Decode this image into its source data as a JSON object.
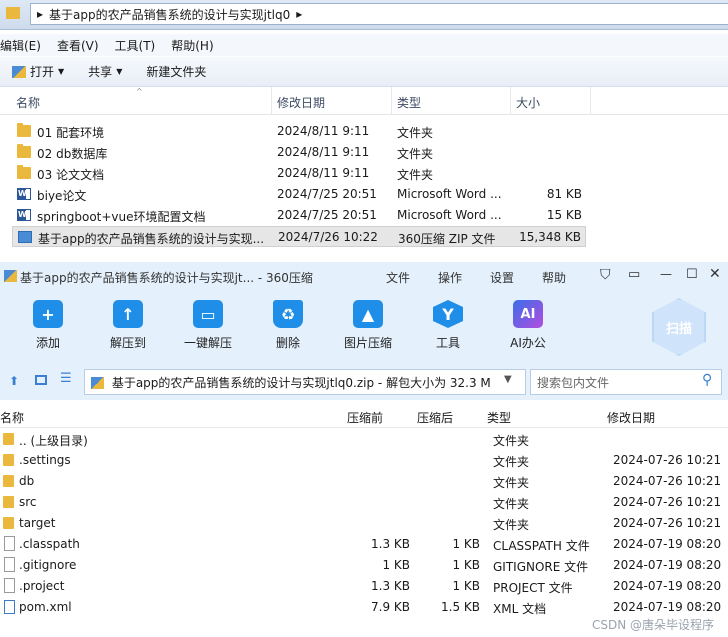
{
  "explorer": {
    "path": "基于app的农产品销售系统的设计与实现jtlq0",
    "menu": [
      "编辑(E)",
      "查看(V)",
      "工具(T)",
      "帮助(H)"
    ],
    "toolbar": {
      "open": "打开",
      "share": "共享",
      "new_folder": "新建文件夹"
    },
    "columns": {
      "name": "名称",
      "date": "修改日期",
      "type": "类型",
      "size": "大小"
    },
    "files": [
      {
        "name": "01 配套环境",
        "date": "2024/8/11 9:11",
        "type": "文件夹",
        "size": "",
        "icon": "folder-icon"
      },
      {
        "name": "02 db数据库",
        "date": "2024/8/11 9:11",
        "type": "文件夹",
        "size": "",
        "icon": "folder-icon"
      },
      {
        "name": "03 论文文档",
        "date": "2024/8/11 9:11",
        "type": "文件夹",
        "size": "",
        "icon": "folder-icon"
      },
      {
        "name": "biye论文",
        "date": "2024/7/25 20:51",
        "type": "Microsoft Word ...",
        "size": "81 KB",
        "icon": "word-doc-icon"
      },
      {
        "name": "springboot+vue环境配置文档",
        "date": "2024/7/25 20:51",
        "type": "Microsoft Word ...",
        "size": "15 KB",
        "icon": "word-doc-icon"
      },
      {
        "name": "基于app的农产品销售系统的设计与实现...",
        "date": "2024/7/26 10:22",
        "type": "360压缩 ZIP 文件",
        "size": "15,348 KB",
        "icon": "zip-icon"
      }
    ]
  },
  "zip": {
    "title": "基于app的农产品销售系统的设计与实现jt... - 360压缩",
    "menu": [
      "文件",
      "操作",
      "设置",
      "帮助"
    ],
    "tools": [
      {
        "label": "添加",
        "icon": "add-icon",
        "color": "#1e8ee8"
      },
      {
        "label": "解压到",
        "icon": "extract-to-icon",
        "color": "#1e8ee8"
      },
      {
        "label": "一键解压",
        "icon": "one-click-extract-icon",
        "color": "#1e8ee8"
      },
      {
        "label": "删除",
        "icon": "delete-icon",
        "color": "#1e8ee8"
      },
      {
        "label": "图片压缩",
        "icon": "image-compress-icon",
        "color": "#1e8ee8"
      },
      {
        "label": "工具",
        "icon": "tools-icon",
        "color": "#1e8ee8"
      },
      {
        "label": "AI办公",
        "icon": "ai-office-icon",
        "color": "#3a6fe8"
      }
    ],
    "scan_label": "扫描",
    "path": "基于app的农产品销售系统的设计与实现jtlq0.zip - 解包大小为 32.3 M",
    "search_placeholder": "搜索包内文件",
    "columns": {
      "name": "名称",
      "compressed": "压缩前",
      "after": "压缩后",
      "type": "类型",
      "modified": "修改日期"
    },
    "entries": [
      {
        "name": ".. (上级目录)",
        "before": "",
        "after": "",
        "type": "文件夹",
        "date": "",
        "icon": "folder-icon"
      },
      {
        "name": ".settings",
        "before": "",
        "after": "",
        "type": "文件夹",
        "date": "2024-07-26 10:21",
        "icon": "folder-icon"
      },
      {
        "name": "db",
        "before": "",
        "after": "",
        "type": "文件夹",
        "date": "2024-07-26 10:21",
        "icon": "folder-icon"
      },
      {
        "name": "src",
        "before": "",
        "after": "",
        "type": "文件夹",
        "date": "2024-07-26 10:21",
        "icon": "folder-icon"
      },
      {
        "name": "target",
        "before": "",
        "after": "",
        "type": "文件夹",
        "date": "2024-07-26 10:21",
        "icon": "folder-icon"
      },
      {
        "name": ".classpath",
        "before": "1.3 KB",
        "after": "1 KB",
        "type": "CLASSPATH 文件",
        "date": "2024-07-19 08:20",
        "icon": "file-icon"
      },
      {
        "name": ".gitignore",
        "before": "1 KB",
        "after": "1 KB",
        "type": "GITIGNORE 文件",
        "date": "2024-07-19 08:20",
        "icon": "file-icon"
      },
      {
        "name": ".project",
        "before": "1.3 KB",
        "after": "1 KB",
        "type": "PROJECT 文件",
        "date": "2024-07-19 08:20",
        "icon": "file-icon"
      },
      {
        "name": "pom.xml",
        "before": "7.9 KB",
        "after": "1.5 KB",
        "type": "XML 文档",
        "date": "2024-07-19 08:20",
        "icon": "xml-file-icon"
      }
    ]
  },
  "watermark": "CSDN @唐朵毕设程序"
}
